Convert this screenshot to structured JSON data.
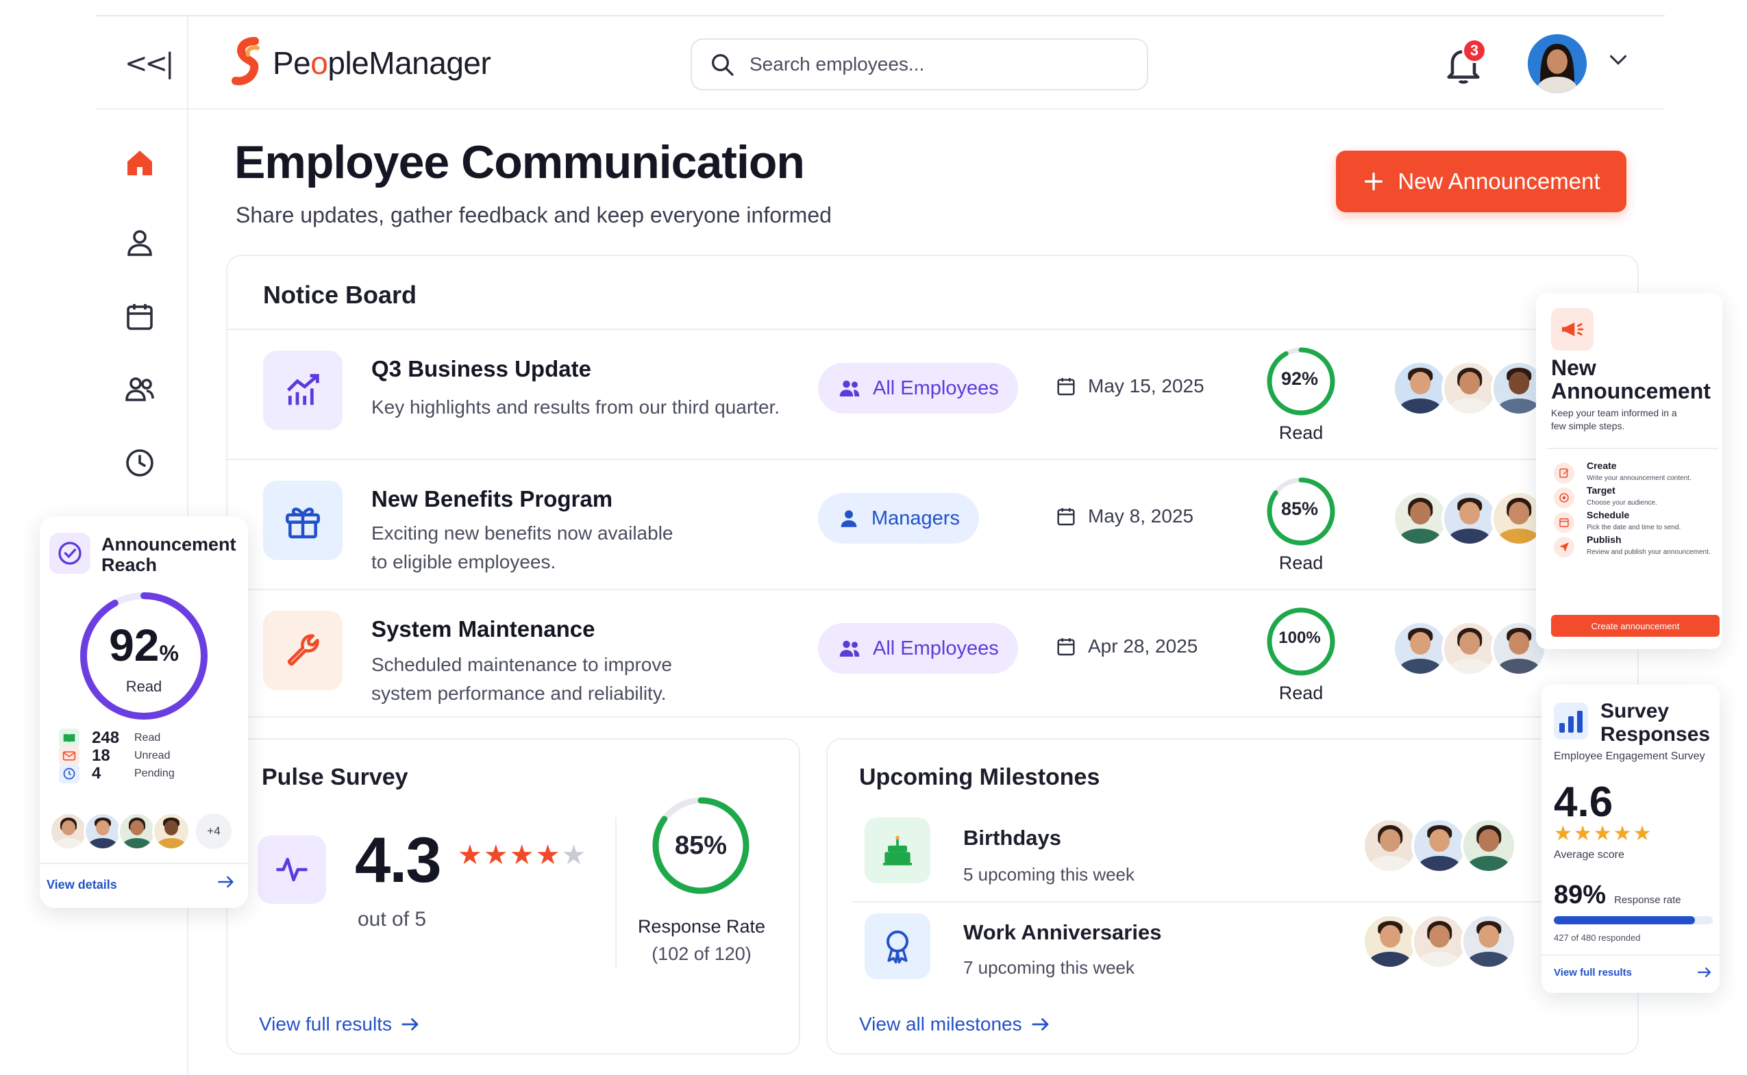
{
  "app": {
    "brand_prefix": "Pe",
    "brand_accent": "o",
    "brand_suffix": "pleManager",
    "collapse_label": "<<|",
    "search_placeholder": "Search employees...",
    "notifications_count": "3",
    "accent_color": "#f24c2c"
  },
  "sidebar": {
    "items": [
      {
        "icon": "home-icon",
        "active": true
      },
      {
        "icon": "user-icon"
      },
      {
        "icon": "calendar-icon"
      },
      {
        "icon": "team-icon"
      },
      {
        "icon": "clock-icon"
      }
    ]
  },
  "header": {
    "title": "Employee Communication",
    "subtitle": "Share updates, gather feedback and keep everyone informed",
    "new_button_label": "New Announcement"
  },
  "notice_board": {
    "title": "Notice Board",
    "rows": [
      {
        "title": "Q3 Business Update",
        "desc": "Key highlights and results from our third quarter.",
        "audience": "All Employees",
        "date": "May 15, 2025",
        "read_pct": "92%",
        "read_value": 92,
        "read_label": "Read",
        "icon": "chart-up-icon"
      },
      {
        "title": "New Benefits Program",
        "desc": "Exciting new benefits now available to eligible employees.",
        "audience": "Managers",
        "date": "May 8, 2025",
        "read_pct": "85%",
        "read_value": 85,
        "read_label": "Read",
        "icon": "gift-icon"
      },
      {
        "title": "System Maintenance",
        "desc": "Scheduled maintenance to improve system performance and reliability.",
        "audience": "All Employees",
        "date": "Apr 28, 2025",
        "read_pct": "100%",
        "read_value": 100,
        "read_label": "Read",
        "icon": "wrench-icon"
      }
    ]
  },
  "reach": {
    "title": "Announcement Reach",
    "value": "92",
    "unit": "%",
    "value_label": "Read",
    "percent": 92,
    "stats": [
      {
        "count": "248",
        "label": "Read"
      },
      {
        "count": "18",
        "label": "Unread"
      },
      {
        "count": "4",
        "label": "Pending"
      }
    ],
    "more_label": "+4",
    "link": "View details"
  },
  "pulse": {
    "title": "Pulse Survey",
    "score": "4.3",
    "out_of": "out of 5",
    "stars_filled": 4,
    "response_pct": "85%",
    "response_value": 85,
    "response_label": "Response Rate",
    "response_count": "(102 of 120)",
    "link": "View full results"
  },
  "milestones": {
    "title": "Upcoming Milestones",
    "items": [
      {
        "title": "Birthdays",
        "sub": "5 upcoming this week",
        "icon": "cake-icon"
      },
      {
        "title": "Work Anniversaries",
        "sub": "7 upcoming this week",
        "icon": "award-icon"
      }
    ],
    "link": "View all milestones"
  },
  "new_announcement": {
    "title": "New Announcement",
    "subtitle": "Keep your team informed in a few simple steps.",
    "steps": [
      {
        "title": "Create",
        "desc": "Write your announcement content."
      },
      {
        "title": "Target",
        "desc": "Choose your audience."
      },
      {
        "title": "Schedule",
        "desc": "Pick the date and time to send."
      },
      {
        "title": "Publish",
        "desc": "Review and publish your announcement."
      }
    ],
    "button": "Create announcement"
  },
  "survey_responses": {
    "title": "Survey Responses",
    "subtitle": "Employee Engagement Survey",
    "score": "4.6",
    "stars": "★★★★★",
    "score_label": "Average score",
    "rate": "89%",
    "rate_label": "Response rate",
    "rate_value": 89,
    "responded": "427 of 480 responded",
    "link": "View full results"
  }
}
